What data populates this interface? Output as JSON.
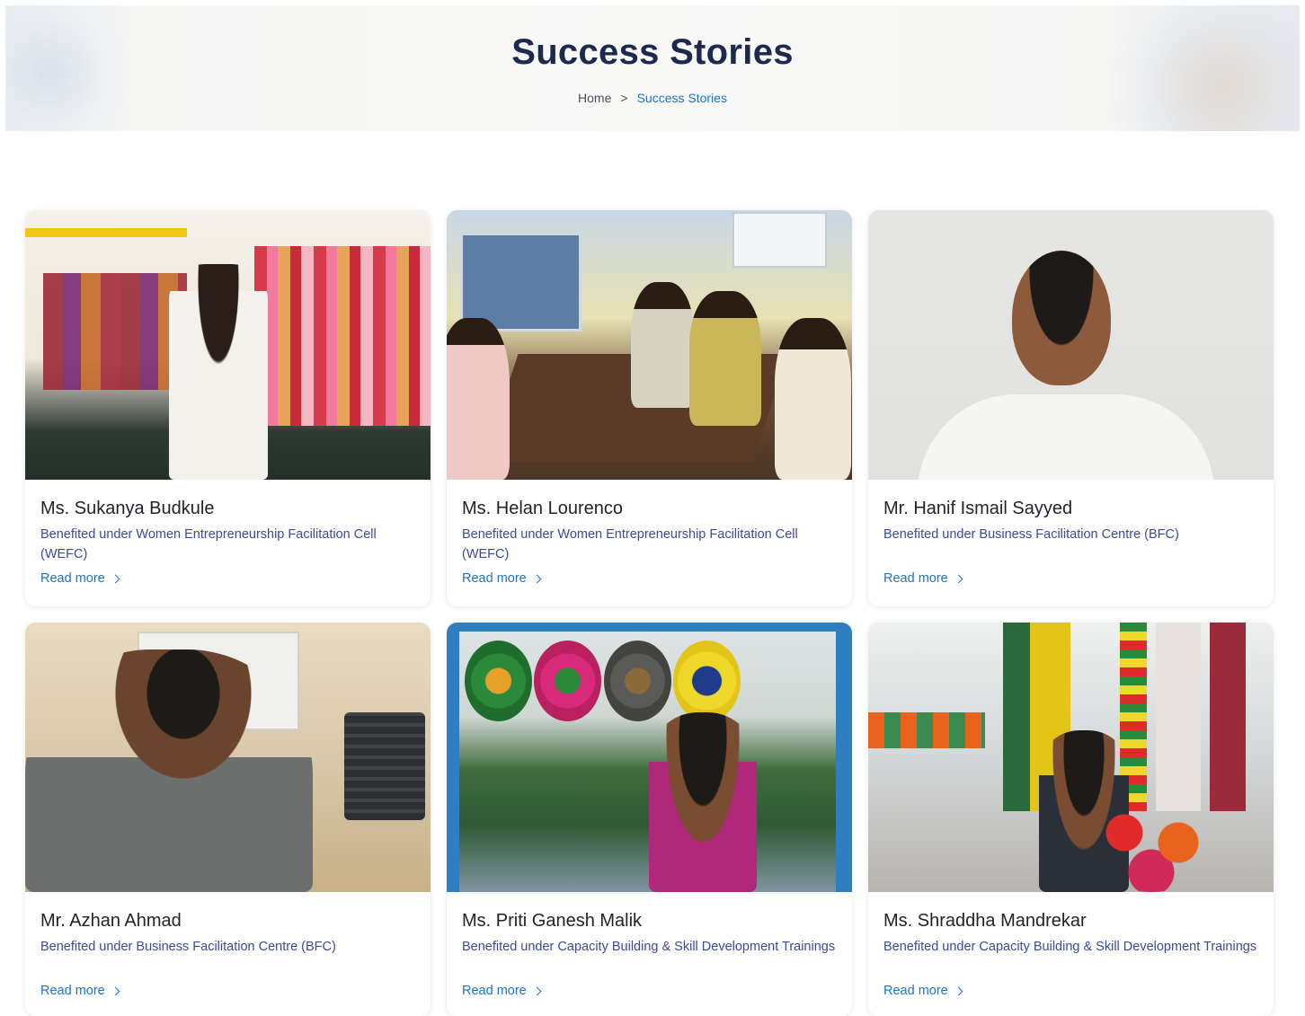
{
  "header": {
    "title": "Success Stories",
    "breadcrumb": {
      "home": "Home",
      "separator": ">",
      "current": "Success Stories"
    }
  },
  "colors": {
    "title": "#1b2a4e",
    "accent": "#1e73c7",
    "description": "#3c4a9a"
  },
  "stories": [
    {
      "name": "Ms. Sukanya Budkule",
      "description": "Benefited under Women Entrepreneurship Facilitation Cell (WEFC)",
      "link": "Read more"
    },
    {
      "name": "Ms. Helan Lourenco",
      "description": "Benefited under Women Entrepreneurship Facilitation Cell (WEFC)",
      "link": "Read more"
    },
    {
      "name": "Mr. Hanif Ismail Sayyed",
      "description": "Benefited under Business Facilitation Centre (BFC)",
      "link": "Read more"
    },
    {
      "name": "Mr. Azhan Ahmad",
      "description": "Benefited under Business Facilitation Centre (BFC)",
      "link": "Read more"
    },
    {
      "name": "Ms. Priti Ganesh Malik",
      "description": "Benefited under Capacity Building & Skill Development Trainings",
      "link": "Read more"
    },
    {
      "name": "Ms. Shraddha Mandrekar",
      "description": "Benefited under Capacity Building & Skill Development Trainings",
      "link": "Read more"
    }
  ]
}
